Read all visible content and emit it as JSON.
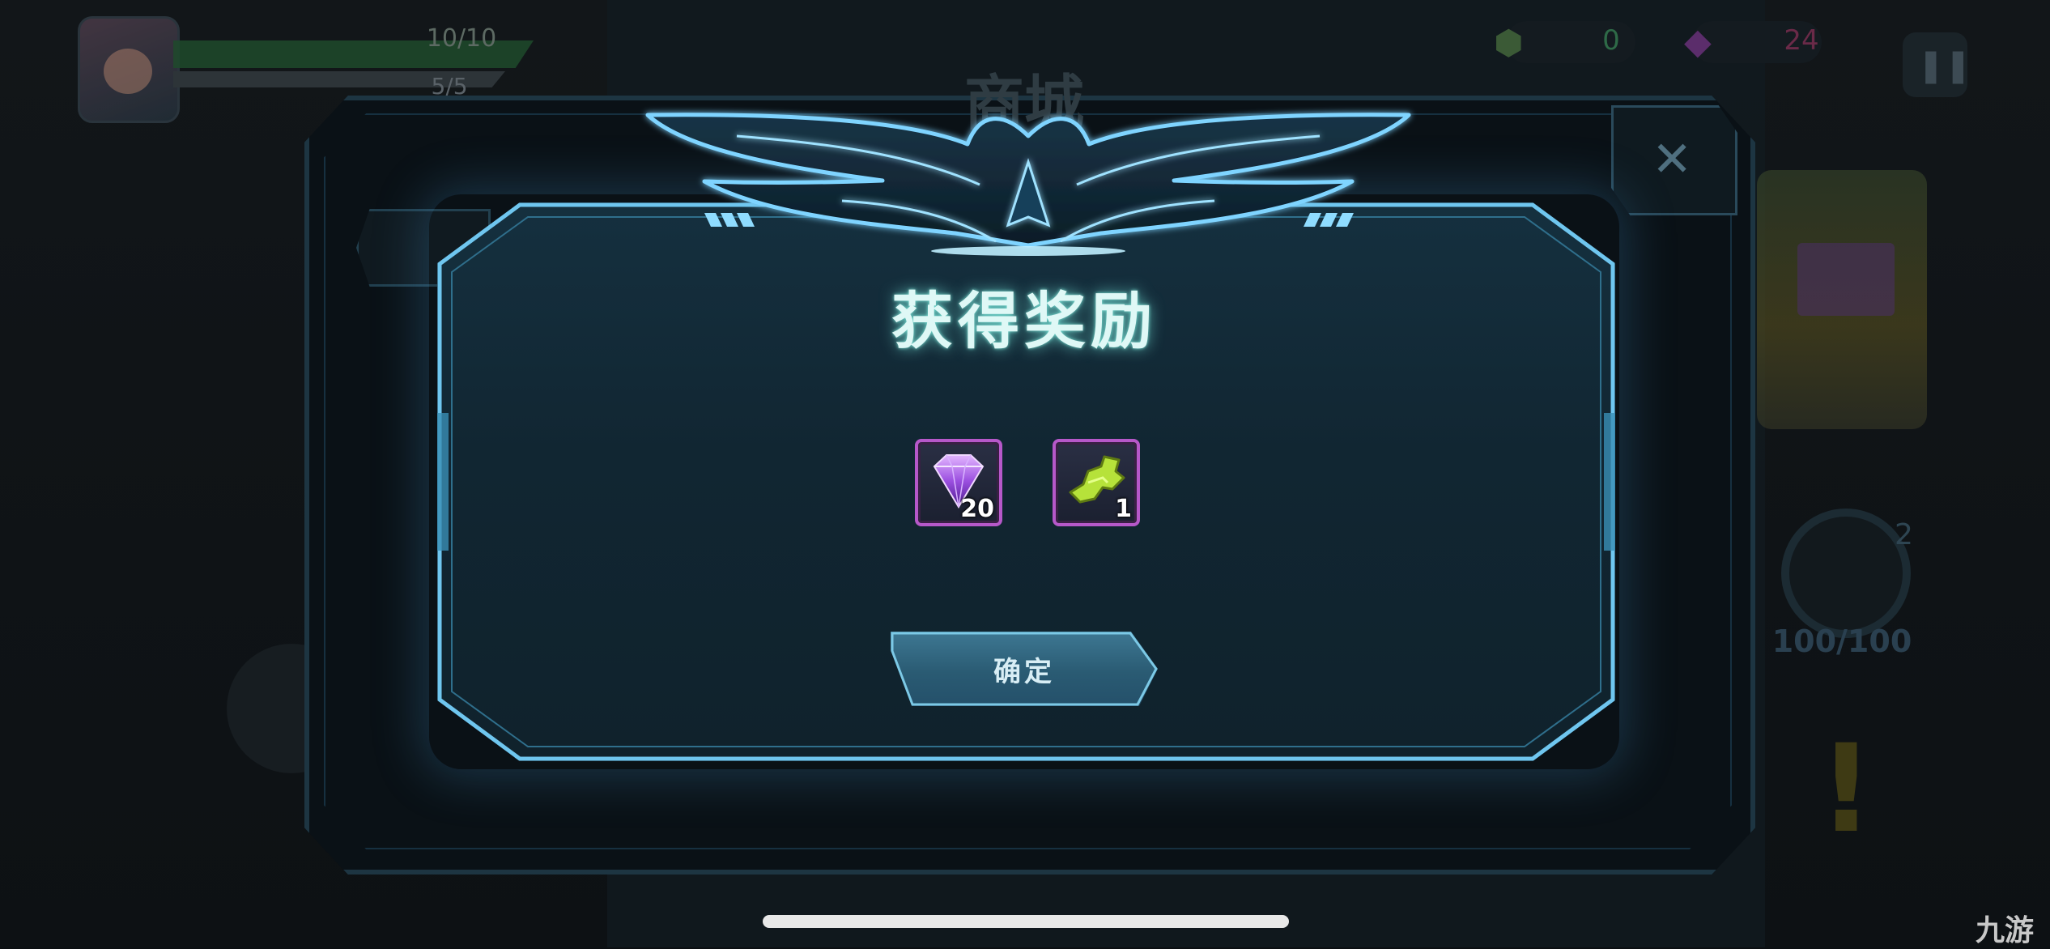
{
  "hud": {
    "hp_text": "10/10",
    "hp_fraction": 1.0,
    "ap_text": "5/5",
    "gold_value": "0",
    "gem_value": "24",
    "shop_title": "商城",
    "weapon_ammo": "2",
    "weapon_hp": "100/100"
  },
  "dialog": {
    "title": "获得奖励",
    "confirm_label": "确定",
    "rewards": [
      {
        "name": "gem",
        "count": "20"
      },
      {
        "name": "weapon-part",
        "count": "1"
      }
    ]
  },
  "close_symbol": "✕",
  "pause_symbol": "❚❚",
  "alert_symbol": "!",
  "watermark": "九游",
  "colors": {
    "dialog_border": "#6fc6ef",
    "title_glow": "#7fe7d8",
    "item_frame": "#b658c9",
    "button": "#2a5b73"
  },
  "icons": {
    "gem": "purple-gem-icon",
    "part": "green-weapon-part-icon",
    "emblem": "eagle-wings-emblem"
  }
}
